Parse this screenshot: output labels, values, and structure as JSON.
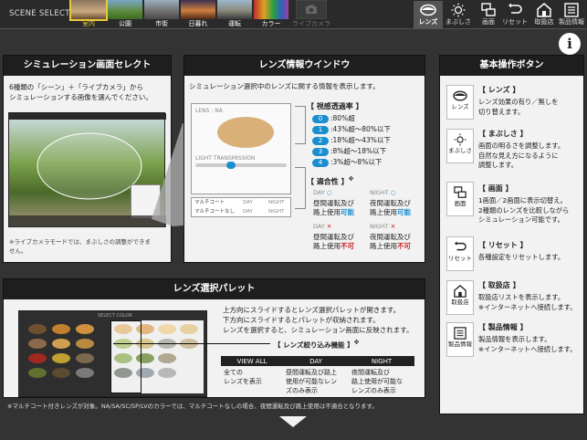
{
  "topbar": {
    "scene_select": "SCENE SELECT",
    "scenes": [
      {
        "label": "室内",
        "selected": true,
        "dim": false
      },
      {
        "label": "公園",
        "selected": false,
        "dim": false
      },
      {
        "label": "市街",
        "selected": false,
        "dim": false
      },
      {
        "label": "日暮れ",
        "selected": false,
        "dim": false
      },
      {
        "label": "運転",
        "selected": false,
        "dim": false
      },
      {
        "label": "カラー",
        "selected": false,
        "dim": false
      },
      {
        "label": "ライブカメラ",
        "selected": false,
        "dim": true
      }
    ],
    "buttons": [
      {
        "label": "レンズ",
        "icon": "lens-icon",
        "active": true
      },
      {
        "label": "まぶしさ",
        "icon": "sun-icon",
        "active": false
      },
      {
        "label": "画面",
        "icon": "screen-icon",
        "active": false
      },
      {
        "label": "リセット",
        "icon": "reset-icon",
        "active": false
      },
      {
        "label": "取扱店",
        "icon": "store-icon",
        "active": false
      },
      {
        "label": "製品情報",
        "icon": "info-list-icon",
        "active": false
      }
    ],
    "info_button": "i"
  },
  "sim_select": {
    "title": "シミュレーション画面セレクト",
    "desc_1": "6種類の「シーン」＋「ライブカメラ」から",
    "desc_2": "シミュレーションする画像を選んでください。",
    "note_1": "※ライブカメラモードでは、まぶしさの調整ができま",
    "note_2": "せん。"
  },
  "lens_info": {
    "title": "レンズ情報ウインドウ",
    "desc": "シミュレーション選択中のレンズに関する情報を表示します。",
    "mock_lens": "LENS : NA",
    "mock_transmission": "LIGHT TRANSMISSION",
    "mock_multicoat": "マルチコート",
    "mock_no_multicoat": "マルチコートなし",
    "mock_day": "DAY",
    "mock_night": "NIGHT",
    "transmission_title": "【 視感透過率 】",
    "levels": [
      {
        "badge": "0",
        "text": ":80%超"
      },
      {
        "badge": "1",
        "text": ":43%超～80%以下"
      },
      {
        "badge": "2",
        "text": ":18%超～43%以下"
      },
      {
        "badge": "3",
        "text": ":8%超～18%以下"
      },
      {
        "badge": "4",
        "text": ":3%超～8%以下"
      }
    ],
    "suitability_title": "【 適合性 】",
    "suitability_mark": "※",
    "day": "DAY",
    "night": "NIGHT",
    "ok_prefix_1": "昼間運転及び",
    "ok_prefix_2": "路上使用",
    "ok_day": "可能",
    "night_prefix_1": "夜間運転及び",
    "night_prefix_2": "路上使用",
    "ok_night": "可能",
    "ng_day": "不可",
    "ng_night": "不可"
  },
  "palette": {
    "title": "レンズ選択パレット",
    "desc_1": "上方向にスライドするとレンズ選択パレットが開きます。",
    "desc_2": "下方向にスライドするとパレットが収納されます。",
    "desc_3": "レンズを選択すると、シミュレーション画面に反映されます。",
    "filter_title": "【 レンズ絞り込み機能 】",
    "filter_mark": "※",
    "columns": [
      "VIEW ALL",
      "DAY",
      "NIGHT"
    ],
    "cells": [
      [
        "全ての",
        "レンズを表示"
      ],
      [
        "昼間運転及び路上",
        "使用が可能なレン",
        "ズのみ表示"
      ],
      [
        "夜間運転及び",
        "路上使用が可能な",
        "レンズのみ表示"
      ]
    ],
    "mock_label": "SELECT COLOR"
  },
  "footnote": "※マルチコート付きレンズが対象。NA/SA/SC/SP/LVのカラーでは、マルチコートなしの場合、夜間運転及び路上使用は不適合となります。",
  "basic_ops": {
    "title": "基本操作ボタン",
    "items": [
      {
        "icon_label": "レンズ",
        "title": "【 レンズ 】",
        "lines": [
          "レンズ効果の有り／無しを",
          "切り替えます。"
        ]
      },
      {
        "icon_label": "まぶしさ",
        "title": "【 まぶしさ 】",
        "lines": [
          "画面の明るさを調整します。",
          "自然な見え方になるように",
          "調整します。"
        ]
      },
      {
        "icon_label": "画面",
        "title": "【 画面 】",
        "lines": [
          "1画面／2画面に表示切替え。",
          "2種類のレンズを比較しながら",
          "シミュレーション可能です。"
        ]
      },
      {
        "icon_label": "リセット",
        "title": "【 リセット 】",
        "lines": [
          "各種設定をリセットします。"
        ]
      },
      {
        "icon_label": "取扱店",
        "title": "【 取扱店 】",
        "lines": [
          "取扱店リストを表示します。",
          "※インターネットへ接続します。"
        ]
      },
      {
        "icon_label": "製品情報",
        "title": "【 製品情報 】",
        "lines": [
          "製品情報を表示します。",
          "※インターネットへ接続します。"
        ]
      }
    ]
  },
  "colors": {
    "accent_blue": "#1a8fd0",
    "alert_red": "#d02525",
    "selected_gold": "#e8c93d",
    "header_dark": "#1e1e1e"
  }
}
